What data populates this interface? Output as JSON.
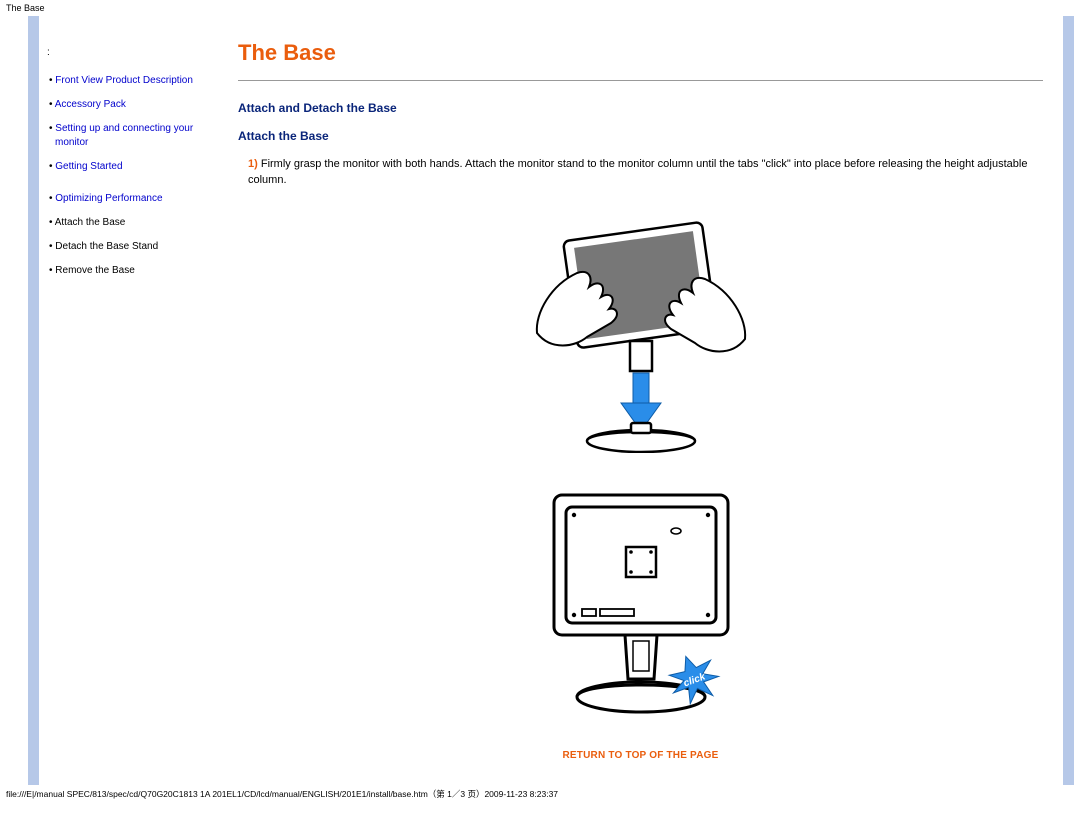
{
  "header_label": "The Base",
  "sidebar": {
    "items": [
      {
        "label": "Front View Product Description",
        "link": true
      },
      {
        "label": "Accessory Pack",
        "link": true
      },
      {
        "label": "Setting up and connecting your monitor",
        "link": true
      },
      {
        "label": "Getting Started",
        "link": true
      },
      {
        "label": "Optimizing Performance",
        "link": true
      },
      {
        "label": "Attach the Base",
        "link": false
      },
      {
        "label": "Detach the Base Stand",
        "link": false
      },
      {
        "label": "Remove the Base",
        "link": false
      }
    ]
  },
  "main": {
    "title": "The Base",
    "subtitle1": "Attach and Detach the Base",
    "subtitle2": "Attach the Base",
    "step_number": "1)",
    "step_text": "Firmly grasp the monitor with both hands. Attach the monitor stand to the monitor column until the tabs \"click\" into place before releasing the height adjustable column.",
    "return_top": "RETURN TO TOP OF THE PAGE",
    "click_badge": "click"
  },
  "footer": "file:///E|/manual SPEC/813/spec/cd/Q70G20C1813 1A 201EL1/CD/lcd/manual/ENGLISH/201E1/install/base.htm（第 1／3 页）2009-11-23 8:23:37"
}
